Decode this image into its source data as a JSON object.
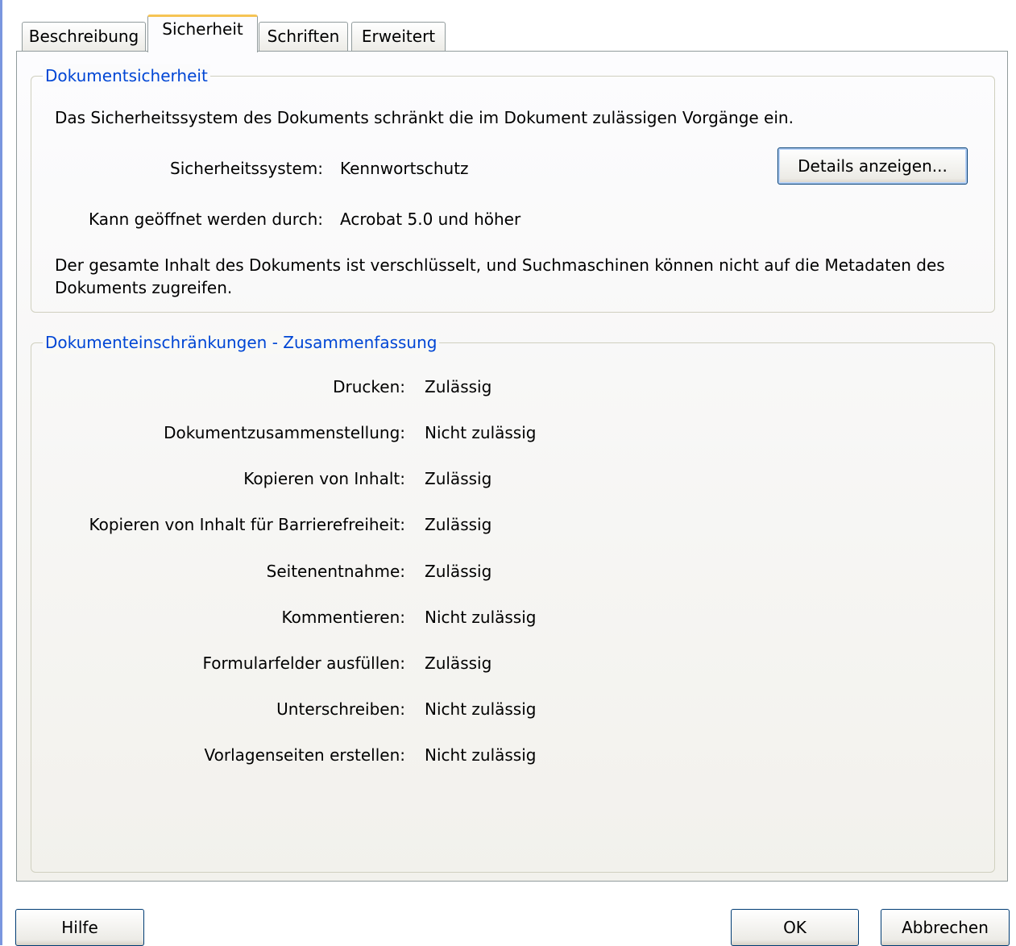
{
  "tabs": [
    {
      "label": "Beschreibung",
      "active": false
    },
    {
      "label": "Sicherheit",
      "active": true
    },
    {
      "label": "Schriften",
      "active": false
    },
    {
      "label": "Erweitert",
      "active": false
    }
  ],
  "security": {
    "legend": "Dokumentsicherheit",
    "intro": "Das Sicherheitssystem des Dokuments schränkt die im Dokument zulässigen Vorgänge ein.",
    "system_label": "Sicherheitssystem:",
    "system_value": "Kennwortschutz",
    "details_button": "Details anzeigen...",
    "open_label": "Kann geöffnet werden durch:",
    "open_value": "Acrobat 5.0 und höher",
    "note": "Der gesamte Inhalt des Dokuments ist verschlüsselt, und Suchmaschinen können nicht auf die Metadaten des Dokuments zugreifen."
  },
  "restrictions": {
    "legend": "Dokumenteinschränkungen - Zusammenfassung",
    "items": [
      {
        "label": "Drucken:",
        "value": "Zulässig"
      },
      {
        "label": "Dokumentzusammenstellung:",
        "value": "Nicht zulässig"
      },
      {
        "label": "Kopieren von Inhalt:",
        "value": "Zulässig"
      },
      {
        "label": "Kopieren von Inhalt für Barrierefreiheit:",
        "value": "Zulässig"
      },
      {
        "label": "Seitenentnahme:",
        "value": "Zulässig"
      },
      {
        "label": "Kommentieren:",
        "value": "Nicht zulässig"
      },
      {
        "label": "Formularfelder ausfüllen:",
        "value": "Zulässig"
      },
      {
        "label": "Unterschreiben:",
        "value": "Nicht zulässig"
      },
      {
        "label": "Vorlagenseiten erstellen:",
        "value": "Nicht zulässig"
      }
    ]
  },
  "footer": {
    "help_button": "Hilfe",
    "ok_button": "OK",
    "cancel_button": "Abbrechen"
  },
  "colors": {
    "legend": "#0046d5",
    "active_tab_highlight": "#f6c454",
    "button_border": "#003c74"
  }
}
